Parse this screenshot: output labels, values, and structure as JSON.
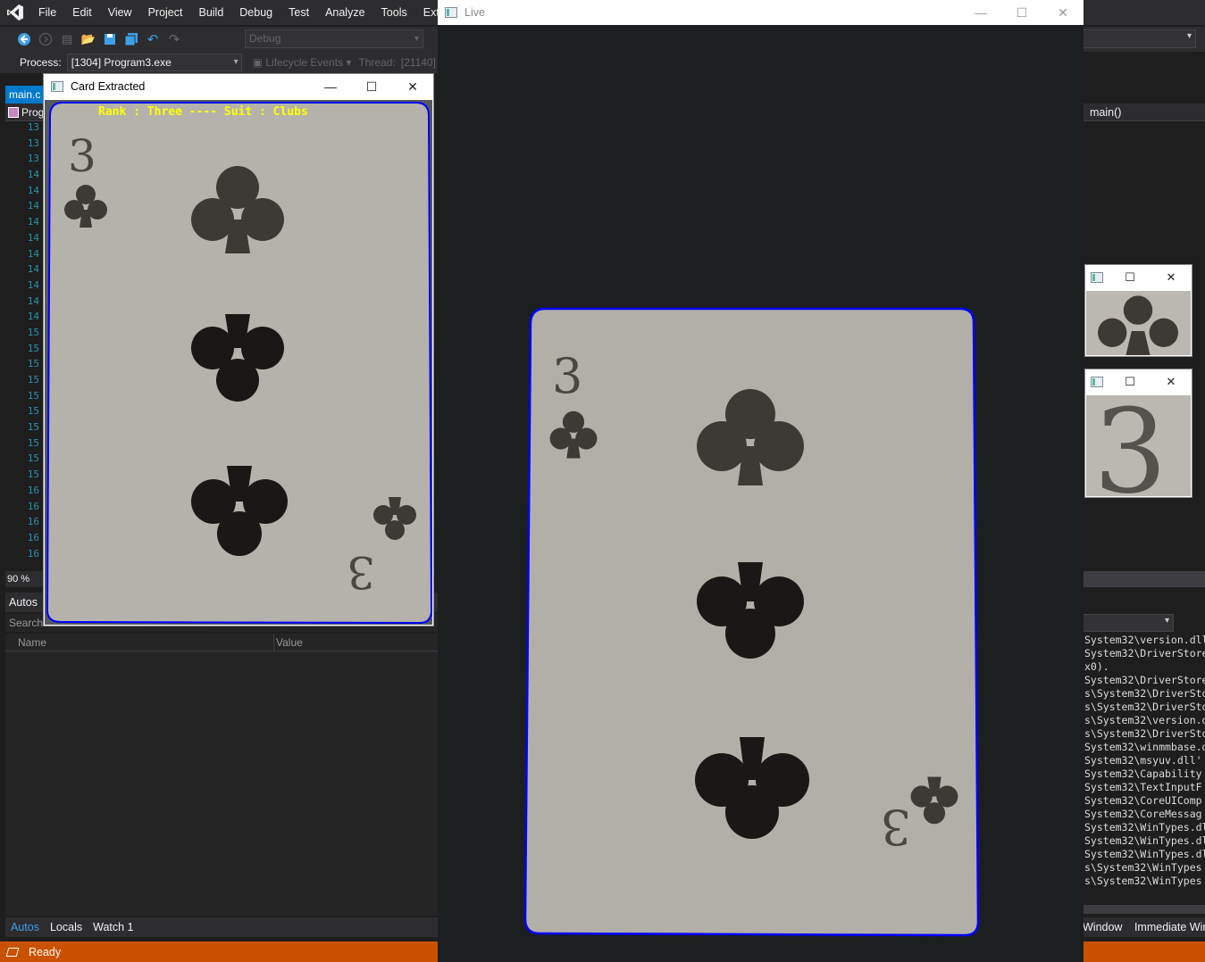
{
  "vs": {
    "menu": [
      "File",
      "Edit",
      "View",
      "Project",
      "Build",
      "Debug",
      "Test",
      "Analyze",
      "Tools",
      "Ext"
    ],
    "toolbar": {
      "config": "Debug"
    },
    "debug_bar": {
      "process_label": "Process:",
      "process_value": "[1304] Program3.exe",
      "lifecycle": "Lifecycle Events",
      "thread_label": "Thread:",
      "thread_value": "[21140]"
    },
    "doc_tab": "main.c",
    "nav_project": "Prog",
    "line_numbers": [
      "13",
      "13",
      "13",
      "14",
      "14",
      "14",
      "14",
      "14",
      "14",
      "14",
      "14",
      "14",
      "14",
      "15",
      "15",
      "15",
      "15",
      "15",
      "15",
      "15",
      "15",
      "15",
      "15",
      "16",
      "16",
      "16",
      "16",
      "16"
    ],
    "zoom": "90 %",
    "function_nav": "main()",
    "autos": {
      "title": "Autos",
      "search": "Search",
      "col_name": "Name",
      "col_value": "Value",
      "tabs": [
        "Autos",
        "Locals",
        "Watch 1"
      ]
    },
    "output_lines": [
      "System32\\version.dll",
      "System32\\DriverStore",
      "x0).",
      "System32\\DriverStore",
      "s\\System32\\DriverSto",
      "s\\System32\\DriverSto",
      "s\\System32\\version.d",
      "s\\System32\\DriverSto",
      "System32\\winmmbase.d",
      "System32\\msyuv.dll'",
      "System32\\Capability",
      "System32\\TextInputF",
      "System32\\CoreUIComp",
      "System32\\CoreMessag",
      "System32\\WinTypes.dl",
      "System32\\WinTypes.dl",
      "System32\\WinTypes.dl",
      "s\\System32\\WinTypes",
      "s\\System32\\WinTypes"
    ],
    "right_tabs": [
      "Window",
      "Immediate Win"
    ],
    "status": "Ready"
  },
  "windows": {
    "card_extracted": {
      "title": "Card Extracted",
      "overlay_text": "Rank : Three ---- Suit : Clubs"
    },
    "live": {
      "title": "Live"
    }
  },
  "card": {
    "rank": "3",
    "suit": "♣"
  },
  "colors": {
    "accent": "#007acc",
    "status_bar": "#ca5100",
    "contour": "#0000ff",
    "overlay_text": "#ffff00"
  }
}
